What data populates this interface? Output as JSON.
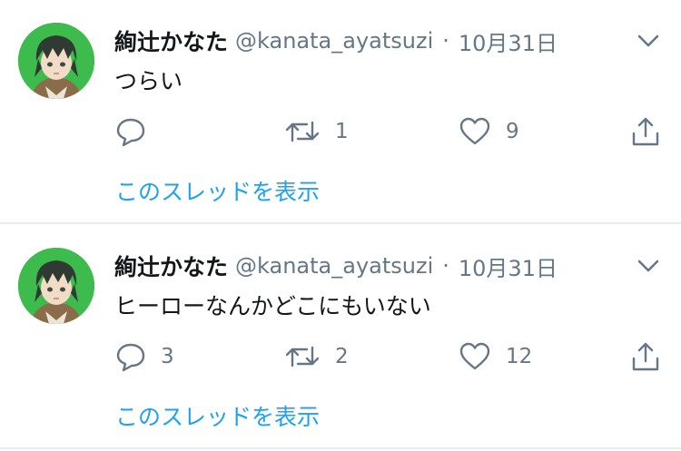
{
  "tweets": [
    {
      "author_name": "絢辻かなた",
      "handle": "@kanata_ayatsuzi",
      "separator": "·",
      "date": "10月31日",
      "text": "つらい",
      "reply_count": "",
      "retweet_count": "1",
      "like_count": "9",
      "thread_link": "このスレッドを表示"
    },
    {
      "author_name": "絢辻かなた",
      "handle": "@kanata_ayatsuzi",
      "separator": "·",
      "date": "10月31日",
      "text": "ヒーローなんかどこにもいない",
      "reply_count": "3",
      "retweet_count": "2",
      "like_count": "12",
      "thread_link": "このスレッドを表示"
    }
  ],
  "colors": {
    "text_primary": "#14171a",
    "text_secondary": "#657786",
    "link": "#1da1f2",
    "divider": "#e6ecf0",
    "avatar_bg": "#39b54a"
  },
  "icons": [
    "reply-icon",
    "retweet-icon",
    "like-icon",
    "share-icon",
    "chevron-down-icon"
  ]
}
